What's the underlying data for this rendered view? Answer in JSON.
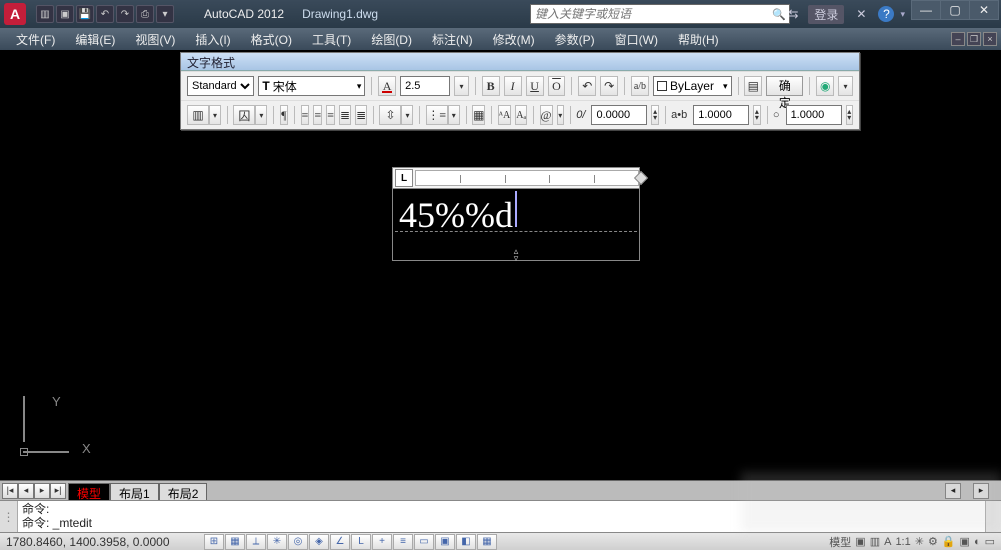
{
  "titlebar": {
    "app_letter": "A",
    "app_name": "AutoCAD 2012",
    "doc_name": "Drawing1.dwg",
    "search_placeholder": "键入关键字或短语",
    "login_label": "登录"
  },
  "menus": [
    "文件(F)",
    "编辑(E)",
    "视图(V)",
    "插入(I)",
    "格式(O)",
    "工具(T)",
    "绘图(D)",
    "标注(N)",
    "修改(M)",
    "参数(P)",
    "窗口(W)",
    "帮助(H)"
  ],
  "textformat": {
    "title": "文字格式",
    "style": "Standard",
    "font_prefix": "T",
    "font": "宋体",
    "height": "2.5",
    "layer": "ByLayer",
    "ok": "确定",
    "oblique": "0.0000",
    "tracking": "1.0000",
    "widthfactor": "1.0000"
  },
  "mtext": {
    "content": "45%%d",
    "ruler_btn": "L"
  },
  "layout_tabs": {
    "active": "模型",
    "tabs": [
      "布局1",
      "布局2"
    ]
  },
  "command": {
    "prompt": "命令:",
    "line": "命令: _mtedit"
  },
  "status": {
    "coords": "1780.8460, 1400.3958, 0.0000",
    "right_label": "模型"
  },
  "ucs": {
    "x": "X",
    "y": "Y"
  }
}
